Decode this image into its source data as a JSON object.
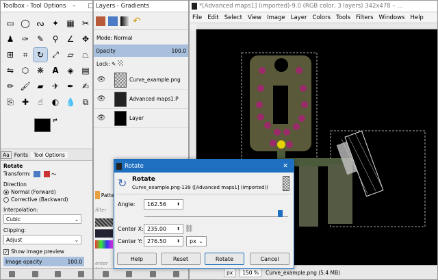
{
  "toolbox": {
    "title": "Toolbox - Tool Options",
    "tabs": [
      "Fonts",
      "Tool Options"
    ],
    "section": "Rotate",
    "transform_label": "Transform:",
    "direction_label": "Direction",
    "direction_options": [
      "Normal (Forward)",
      "Corrective (Backward)"
    ],
    "interpolation_label": "Interpolation:",
    "interpolation_value": "Cubic",
    "clipping_label": "Clipping:",
    "clipping_value": "Adjust",
    "preview_label": "Show image preview",
    "opacity_label": "Image opacity",
    "opacity_value": "100.0"
  },
  "layers": {
    "title": "Layers - Gradients",
    "mode_label": "Mode: Normal",
    "opacity_label": "Opacity",
    "opacity_value": "100.0",
    "lock_label": "Lock:",
    "items": [
      {
        "name": "Curve_example.png"
      },
      {
        "name": "Advanced maps1.P"
      },
      {
        "name": "Layer"
      }
    ],
    "patterns_label": "Patte",
    "filter_placeholder": "filter",
    "tag_placeholder": "enter tag"
  },
  "image": {
    "title": "*[Advanced maps1] (imported)-9.0 (RGB color, 3 layers) 342x478 – ...",
    "menu": [
      "File",
      "Edit",
      "Select",
      "View",
      "Image",
      "Layer",
      "Colors",
      "Tools",
      "Filters",
      "Windows",
      "Help"
    ],
    "unit": "px",
    "zoom": "150 %",
    "status_file": "Curve_example.png (5.4 MB)"
  },
  "rotate_dialog": {
    "title": "Rotate",
    "heading": "Rotate",
    "subtitle": "Curve_example.png-139 ([Advanced maps1] (imported))",
    "angle_label": "Angle:",
    "angle_value": "162.56",
    "center_x_label": "Center X:",
    "center_x_value": "235.00",
    "center_y_label": "Center Y:",
    "center_y_value": "276.50",
    "unit": "px",
    "buttons": {
      "help": "Help",
      "reset": "Reset",
      "rotate": "Rotate",
      "cancel": "Cancel"
    }
  }
}
